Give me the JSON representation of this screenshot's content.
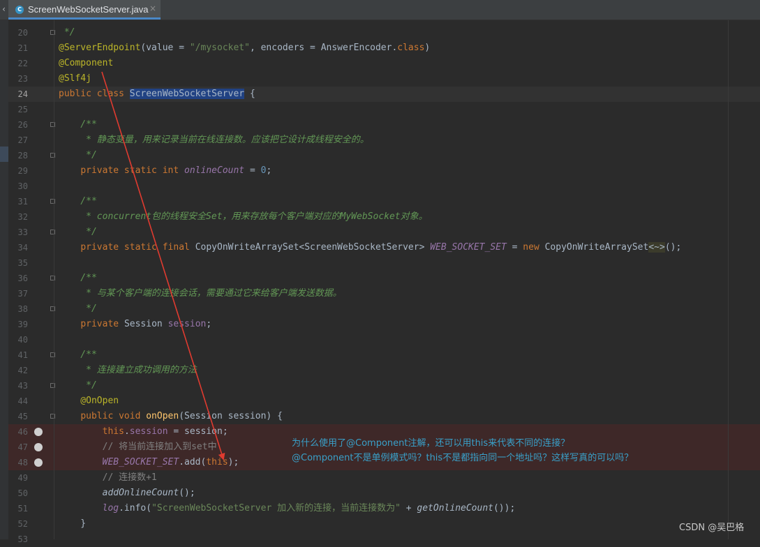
{
  "tab": {
    "file_name": "ScreenWebSocketServer.java",
    "close_glyph": "×",
    "icon_letter": "C"
  },
  "lines": [
    {
      "no": "20",
      "text": " */"
    },
    {
      "no": "21",
      "text": "@ServerEndpoint(value = \"/mysocket\", encoders = AnswerEncoder.class)"
    },
    {
      "no": "22",
      "text": "@Component"
    },
    {
      "no": "23",
      "text": "@Slf4j"
    },
    {
      "no": "24",
      "text": "public class ScreenWebSocketServer {"
    },
    {
      "no": "25",
      "text": ""
    },
    {
      "no": "26",
      "text": "    /**"
    },
    {
      "no": "27",
      "text": "     * 静态变量，用来记录当前在线连接数。应该把它设计成线程安全的。"
    },
    {
      "no": "28",
      "text": "     */"
    },
    {
      "no": "29",
      "text": "    private static int onlineCount = 0;"
    },
    {
      "no": "30",
      "text": ""
    },
    {
      "no": "31",
      "text": "    /**"
    },
    {
      "no": "32",
      "text": "     * concurrent包的线程安全Set，用来存放每个客户端对应的MyWebSocket对象。"
    },
    {
      "no": "33",
      "text": "     */"
    },
    {
      "no": "34",
      "text": "    private static final CopyOnWriteArraySet<ScreenWebSocketServer> WEB_SOCKET_SET = new CopyOnWriteArraySet<~>();"
    },
    {
      "no": "35",
      "text": ""
    },
    {
      "no": "36",
      "text": "    /**"
    },
    {
      "no": "37",
      "text": "     * 与某个客户端的连接会话，需要通过它来给客户端发送数据。"
    },
    {
      "no": "38",
      "text": "     */"
    },
    {
      "no": "39",
      "text": "    private Session session;"
    },
    {
      "no": "40",
      "text": ""
    },
    {
      "no": "41",
      "text": "    /**"
    },
    {
      "no": "42",
      "text": "     * 连接建立成功调用的方法"
    },
    {
      "no": "43",
      "text": "     */"
    },
    {
      "no": "44",
      "text": "    @OnOpen"
    },
    {
      "no": "45",
      "text": "    public void onOpen(Session session) {"
    },
    {
      "no": "46",
      "text": "        this.session = session;"
    },
    {
      "no": "47",
      "text": "        // 将当前连接加入到set中"
    },
    {
      "no": "48",
      "text": "        WEB_SOCKET_SET.add(this);"
    },
    {
      "no": "49",
      "text": "        // 连接数+1"
    },
    {
      "no": "50",
      "text": "        addOnlineCount();"
    },
    {
      "no": "51",
      "text": "        log.info(\"ScreenWebSocketServer 加入新的连接，当前连接数为\" + getOnlineCount());"
    },
    {
      "no": "52",
      "text": "    }"
    },
    {
      "no": "53",
      "text": ""
    }
  ],
  "annotation": {
    "line1": "为什么使用了@Component注解，还可以用this来代表不同的连接？",
    "line2": "@Component不是单例模式吗？this不是都指向同一个地址吗？这样写真的可以吗？"
  },
  "colors": {
    "arrow": "#e03b30",
    "annotation_text": "#39a0c9"
  },
  "watermark": "CSDN @吴巴格"
}
